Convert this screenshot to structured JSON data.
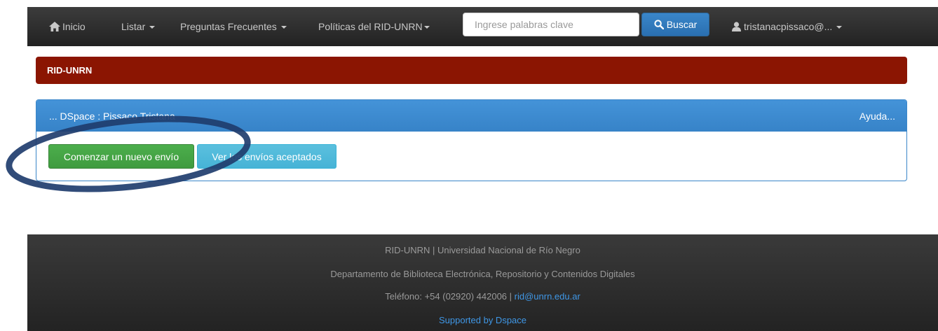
{
  "navbar": {
    "home_label": "Inicio",
    "listar_label": "Listar",
    "faq_label": "Preguntas Frecuentes",
    "policies_label": "Políticas del RID-UNRN",
    "search_placeholder": "Ingrese palabras clave",
    "search_button_label": "Buscar",
    "user_label": "tristanacpissaco@..."
  },
  "brand_bar": {
    "title": "RID-UNRN"
  },
  "panel": {
    "title": "... DSpace : Pissaco Tristana",
    "help_label": "Ayuda...",
    "new_submission_label": "Comenzar un nuevo envío",
    "accepted_submissions_label": "Ver los envíos aceptados"
  },
  "footer": {
    "line1": "RID-UNRN | Universidad Nacional de Río Negro",
    "line2": "Departamento de Biblioteca Electrónica, Repositorio y Contenidos Digitales",
    "phone_text": "Teléfono: +54 (02920) 442006 | ",
    "email": "rid@unrn.edu.ar",
    "supported_by": "Supported by Dspace"
  },
  "colors": {
    "navbar_bg": "#2b2b2b",
    "brand_red": "#8b1502",
    "panel_blue": "#3a86c9",
    "button_green": "#4cae4c",
    "button_cyan": "#5bc0de",
    "annotation_ring": "#1f3d6e"
  }
}
